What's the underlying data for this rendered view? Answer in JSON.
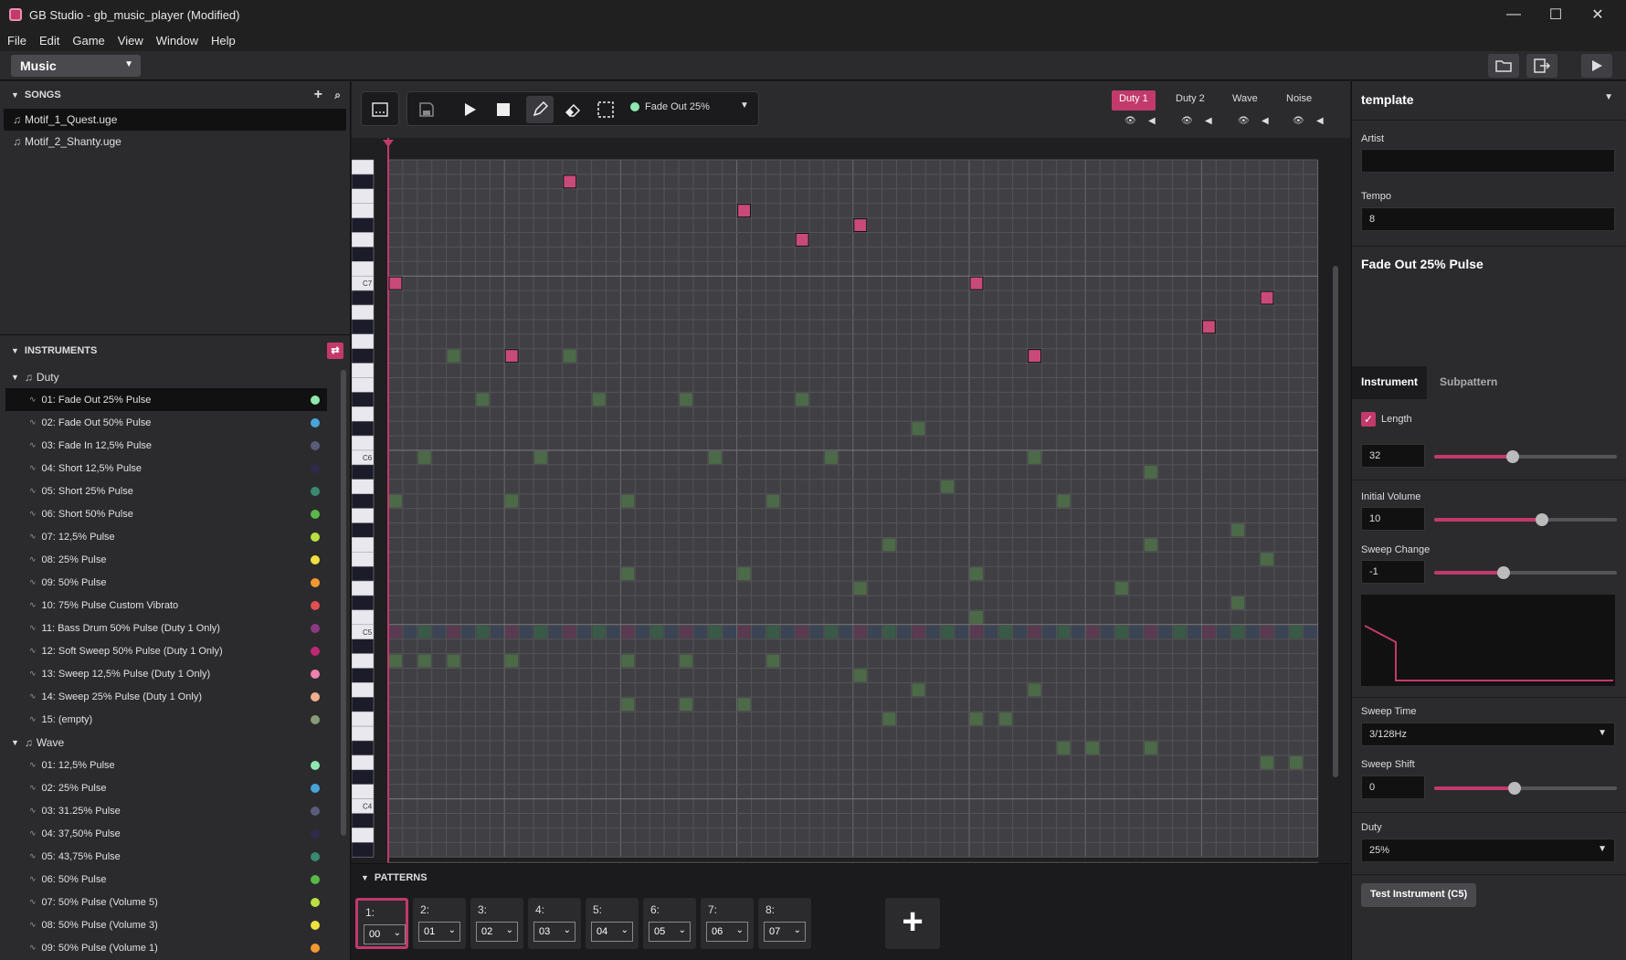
{
  "window": {
    "title": "GB Studio - gb_music_player (Modified)",
    "minimize": "—",
    "maximize": "☐",
    "close": "✕"
  },
  "menu": [
    "File",
    "Edit",
    "Game",
    "View",
    "Window",
    "Help"
  ],
  "section_select": "Music",
  "songs": {
    "header": "SONGS",
    "items": [
      "Motif_1_Quest.uge",
      "Motif_2_Shanty.uge"
    ]
  },
  "instruments": {
    "header": "INSTRUMENTS",
    "groups": [
      {
        "name": "Duty",
        "items": [
          {
            "label": "01: Fade Out 25% Pulse",
            "color": "#8fe8b0"
          },
          {
            "label": "02: Fade Out 50% Pulse",
            "color": "#4aa3d8"
          },
          {
            "label": "03: Fade In 12,5% Pulse",
            "color": "#5a5c7a"
          },
          {
            "label": "04: Short 12,5% Pulse",
            "color": "#2f2a4a"
          },
          {
            "label": "05: Short 25% Pulse",
            "color": "#3a8a70"
          },
          {
            "label": "06: Short 50% Pulse",
            "color": "#58b848"
          },
          {
            "label": "07: 12,5% Pulse",
            "color": "#b8e040"
          },
          {
            "label": "08: 25% Pulse",
            "color": "#f0e040"
          },
          {
            "label": "09: 50% Pulse",
            "color": "#f09830"
          },
          {
            "label": "10: 75% Pulse Custom Vibrato",
            "color": "#e05050"
          },
          {
            "label": "11: Bass Drum 50% Pulse (Duty 1 Only)",
            "color": "#8a3a80"
          },
          {
            "label": "12: Soft Sweep 50% Pulse (Duty 1 Only)",
            "color": "#c02870"
          },
          {
            "label": "13: Sweep 12,5% Pulse (Duty 1 Only)",
            "color": "#f080b0"
          },
          {
            "label": "14: Sweep 25% Pulse (Duty 1 Only)",
            "color": "#f0b090"
          },
          {
            "label": "15: (empty)",
            "color": "#8a9a78"
          }
        ]
      },
      {
        "name": "Wave",
        "items": [
          {
            "label": "01: 12,5% Pulse",
            "color": "#8fe8b0"
          },
          {
            "label": "02: 25% Pulse",
            "color": "#4aa3d8"
          },
          {
            "label": "03: 31.25% Pulse",
            "color": "#5a5c7a"
          },
          {
            "label": "04: 37,50% Pulse",
            "color": "#2f2a4a"
          },
          {
            "label": "05: 43,75% Pulse",
            "color": "#3a8a70"
          },
          {
            "label": "06: 50% Pulse",
            "color": "#58b848"
          },
          {
            "label": "07: 50% Pulse (Volume 5)",
            "color": "#b8e040"
          },
          {
            "label": "08: 50% Pulse (Volume 3)",
            "color": "#f0e040"
          },
          {
            "label": "09: 50% Pulse (Volume 1)",
            "color": "#f09830"
          }
        ]
      }
    ]
  },
  "editor": {
    "current_instrument": "Fade Out 25%",
    "channels": [
      "Duty 1",
      "Duty 2",
      "Wave",
      "Noise"
    ],
    "active_channel": "Duty 1",
    "octave_labels": [
      "C7",
      "C6",
      "C5",
      "C4"
    ],
    "accent_color": "#c2396b"
  },
  "patterns": {
    "header": "PATTERNS",
    "items": [
      {
        "label": "1:",
        "value": "00"
      },
      {
        "label": "2:",
        "value": "01"
      },
      {
        "label": "3:",
        "value": "02"
      },
      {
        "label": "4:",
        "value": "03"
      },
      {
        "label": "5:",
        "value": "04"
      },
      {
        "label": "6:",
        "value": "05"
      },
      {
        "label": "7:",
        "value": "06"
      },
      {
        "label": "8:",
        "value": "07"
      }
    ],
    "add_label": "+"
  },
  "properties": {
    "song_name": "template",
    "artist_label": "Artist",
    "artist_value": "",
    "tempo_label": "Tempo",
    "tempo_value": "8",
    "instrument_title": "Fade Out 25% Pulse",
    "tabs": [
      "Instrument",
      "Subpattern"
    ],
    "length_label": "Length",
    "length_checked": true,
    "length_value": "32",
    "length_fraction": 0.43,
    "initial_volume_label": "Initial Volume",
    "initial_volume_value": "10",
    "initial_volume_fraction": 0.59,
    "sweep_change_label": "Sweep Change",
    "sweep_change_value": "-1",
    "sweep_change_fraction": 0.38,
    "sweep_time_label": "Sweep Time",
    "sweep_time_value": "3/128Hz",
    "sweep_shift_label": "Sweep Shift",
    "sweep_shift_value": "0",
    "sweep_shift_fraction": 0.44,
    "duty_label": "Duty",
    "duty_value": "25%",
    "test_button": "Test Instrument (C5)"
  }
}
